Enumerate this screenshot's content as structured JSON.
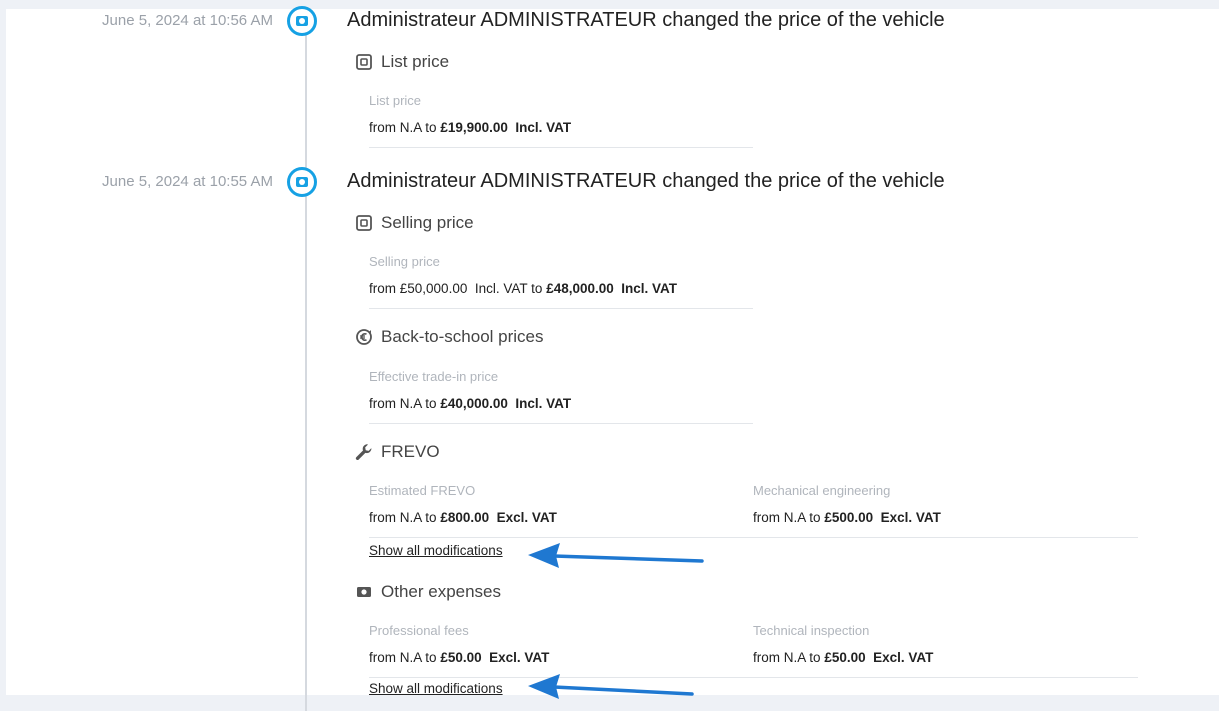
{
  "events": [
    {
      "timestamp": "June 5, 2024 at 10:56 AM",
      "title": "Administrateur ADMINISTRATEUR changed the price of the vehicle",
      "sections": [
        {
          "title": "List price",
          "icon": "wallet-icon",
          "fields": [
            {
              "label": "List price",
              "from_word": "from",
              "from": "N.A",
              "to_word": "to",
              "to": "£19,900.00",
              "to_vat": "Incl. VAT"
            }
          ]
        }
      ]
    },
    {
      "timestamp": "June 5, 2024 at 10:55 AM",
      "title": "Administrateur ADMINISTRATEUR changed the price of the vehicle",
      "sections": [
        {
          "title": "Selling price",
          "icon": "wallet-icon",
          "fields": [
            {
              "label": "Selling price",
              "from_word": "from",
              "from": "£50,000.00",
              "from_vat": "Incl. VAT",
              "to_word": "to",
              "to": "£48,000.00",
              "to_vat": "Incl. VAT"
            }
          ]
        },
        {
          "title": "Back-to-school prices",
          "icon": "euro-exchange-icon",
          "fields": [
            {
              "label": "Effective trade-in price",
              "from_word": "from",
              "from": "N.A",
              "to_word": "to",
              "to": "£40,000.00",
              "to_vat": "Incl. VAT"
            }
          ]
        },
        {
          "title": "FREVO",
          "icon": "wrench-icon",
          "fields": [
            {
              "label": "Estimated FREVO",
              "from_word": "from",
              "from": "N.A",
              "to_word": "to",
              "to": "£800.00",
              "to_vat": "Excl. VAT"
            },
            {
              "label": "Mechanical engineering",
              "from_word": "from",
              "from": "N.A",
              "to_word": "to",
              "to": "£500.00",
              "to_vat": "Excl. VAT"
            }
          ],
          "link": "Show all modifications"
        },
        {
          "title": "Other expenses",
          "icon": "money-bill-icon",
          "fields": [
            {
              "label": "Professional fees",
              "from_word": "from",
              "from": "N.A",
              "to_word": "to",
              "to": "£50.00",
              "to_vat": "Excl. VAT"
            },
            {
              "label": "Technical inspection",
              "from_word": "from",
              "from": "N.A",
              "to_word": "to",
              "to": "£50.00",
              "to_vat": "Excl. VAT"
            }
          ],
          "link": "Show all modifications"
        }
      ]
    }
  ],
  "colors": {
    "accent": "#16a1e4",
    "annotation_arrow": "#1f78d1",
    "timestamp": "#9ba1a9",
    "field_label": "#b0b5bc"
  }
}
